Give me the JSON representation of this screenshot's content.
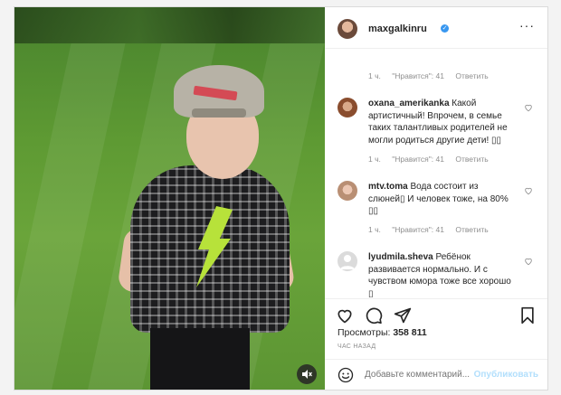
{
  "post": {
    "username": "maxgalkinru",
    "verified_icon": "verified-badge-icon",
    "more_icon": "more-options-icon"
  },
  "comments": [
    {
      "author": "",
      "text": "",
      "time": "1 ч.",
      "likes": "\"Нравится\": 41",
      "reply": "Ответить"
    },
    {
      "author": "oxana_amerikanka",
      "text": "Какой артистичный! Впрочем, в семье таких талантливых родителей не могли родиться другие дети! ▯▯",
      "time": "1 ч.",
      "likes": "\"Нравится\": 41",
      "reply": "Ответить"
    },
    {
      "author": "mtv.toma",
      "text": "Вода состоит из слюней▯ И человек тоже, на 80% ▯▯",
      "time": "1 ч.",
      "likes": "\"Нравится\": 41",
      "reply": "Ответить"
    },
    {
      "author": "lyudmila.sheva",
      "text": "Ребёнок развивается нормально. И с чувством юмора тоже все хорошо ▯",
      "time": "",
      "likes": "",
      "reply": ""
    }
  ],
  "stats": {
    "views_label": "Просмотры:",
    "views_value": "358 811",
    "time_ago": "ЧАС НАЗАД"
  },
  "composer": {
    "placeholder": "Добавьте комментарий...",
    "post_label": "Опубликовать"
  },
  "colors": {
    "accent_blue": "#3897f0",
    "post_disabled": "#b2dffc",
    "muted_text": "#8e8e8e"
  },
  "icons": [
    "heart-icon",
    "comment-icon",
    "share-icon",
    "bookmark-icon",
    "emoji-icon",
    "mute-icon"
  ]
}
